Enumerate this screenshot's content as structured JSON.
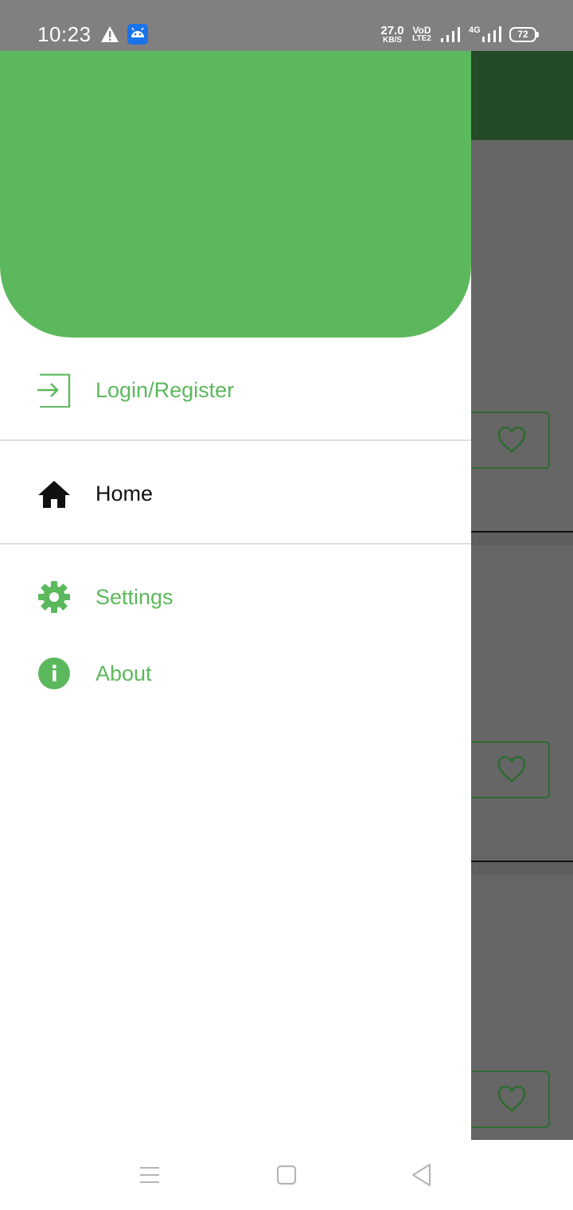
{
  "status_bar": {
    "time": "10:23",
    "net_speed_value": "27.0",
    "net_speed_unit": "KB/S",
    "volte_top": "VoD",
    "volte_bottom": "LTE2",
    "network_type": "4G",
    "battery": "72",
    "icons": [
      "warning-icon",
      "android-debug-icon",
      "signal-icon",
      "signal-4g-icon",
      "battery-icon"
    ]
  },
  "drawer": {
    "header_color": "#5cb85c",
    "items": [
      {
        "label": "Login/Register",
        "icon": "login-icon",
        "color": "#5cb85c"
      },
      {
        "label": "Home",
        "icon": "home-icon",
        "color": "#111111"
      },
      {
        "label": "Settings",
        "icon": "gear-icon",
        "color": "#5cb85c"
      },
      {
        "label": "About",
        "icon": "info-icon",
        "color": "#5cb85c"
      }
    ]
  },
  "background_app": {
    "toolbar_color": "#254a27",
    "favorite_buttons": [
      "heart-icon",
      "heart-icon",
      "heart-icon"
    ]
  },
  "nav_bar": {
    "buttons": [
      "recents-icon",
      "home-icon",
      "back-icon"
    ]
  }
}
